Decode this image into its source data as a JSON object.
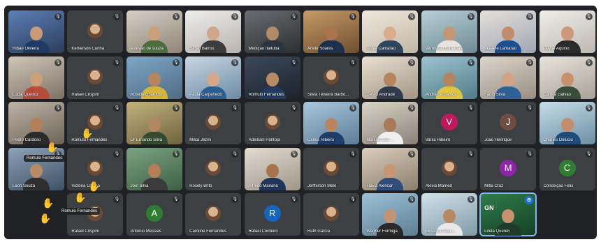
{
  "colors": {
    "stage_background": "#202124",
    "tile_background": "#3c4043",
    "pin_accent": "#1a73e8"
  },
  "participants": [
    {
      "name": "Ribão Oliveira",
      "kind": "video",
      "c1": "#5b7fb6",
      "c2": "#2d3d5a",
      "skin": "#c99a76",
      "shirt": "#1f3a63"
    },
    {
      "name": "Kemerson Cunha",
      "kind": "photo",
      "mic_muted": true
    },
    {
      "name": "estevão de souza",
      "kind": "video",
      "c1": "#d6cfc4",
      "c2": "#8f8578",
      "skin": "#c9a07a",
      "shirt": "#4d6d3f"
    },
    {
      "name": "Sarah Barros",
      "kind": "video",
      "c1": "#eeeeee",
      "c2": "#b9b3ad",
      "skin": "#d2a689",
      "shirt": "#3c3c3c"
    },
    {
      "name": "Medição Itaituba",
      "kind": "video",
      "c1": "#6a6d71",
      "c2": "#2c2e31",
      "skin": "#b48a68",
      "shirt": "#2b3540"
    },
    {
      "name": "Arlete Soares",
      "kind": "video",
      "c1": "#c79a68",
      "c2": "#6e4e30",
      "skin": "#a9744f",
      "shirt": "#1e2f4d"
    },
    {
      "name": "Sonia Camarão",
      "kind": "video",
      "c1": "#efe8dc",
      "c2": "#c2b7a6",
      "skin": "#d9ad8b",
      "shirt": "#2d4660"
    },
    {
      "name": "Verônica Guimarães",
      "kind": "video",
      "c1": "#b7d0d7",
      "c2": "#6f8a93",
      "skin": "#c79773",
      "shirt": "#e8e3dd"
    },
    {
      "name": "Mikaele Lamarão",
      "kind": "video",
      "c1": "#e5e0d9",
      "c2": "#9fa6b4",
      "skin": "#c18c67",
      "shirt": "#1d4f8f"
    },
    {
      "name": "Dayse Aquino",
      "kind": "video",
      "c1": "#f0eeea",
      "c2": "#bdb7b0",
      "skin": "#cc9a78",
      "shirt": "#2b2b2b"
    },
    {
      "name": "Luiza Queiroz",
      "kind": "video",
      "c1": "#cfc6ba",
      "c2": "#7d7266",
      "skin": "#c9a07a",
      "shirt": "#b84a3a"
    },
    {
      "name": "Rafael Crispim",
      "kind": "photo",
      "mic_muted": true
    },
    {
      "name": "Rosicleto Santos",
      "kind": "video",
      "c1": "#7fa7c9",
      "c2": "#4e6b84",
      "skin": "#b8845f",
      "shirt": "#d4b43a"
    },
    {
      "name": "Paula Carpenedo",
      "kind": "video",
      "c1": "#c8d7e3",
      "c2": "#6d8aa5",
      "skin": "#d5a88a",
      "shirt": "#2e5d8f"
    },
    {
      "name": "Romulo Fernandes",
      "kind": "video",
      "c1": "#3c4a5c",
      "c2": "#1b222b",
      "skin": "#b98a66",
      "shirt": "#223a5e"
    },
    {
      "name": "Silvia Teixeira Barbo...",
      "kind": "photo",
      "mic_muted": true
    },
    {
      "name": "Delvid Andrade",
      "kind": "video",
      "c1": "#e8e0d3",
      "c2": "#a39584",
      "skin": "#b78460",
      "shirt": "#2f3a4d"
    },
    {
      "name": "André de Santos",
      "kind": "video",
      "c1": "#9fc3d1",
      "c2": "#4f7c88",
      "skin": "#b5835e",
      "shirt": "#e0c540"
    },
    {
      "name": "Fábio Silva",
      "kind": "video",
      "c1": "#ddd6cc",
      "c2": "#988d80",
      "skin": "#d1a286",
      "shirt": "#2f5f94"
    },
    {
      "name": "Camila Galvão",
      "kind": "video",
      "c1": "#e8e3dc",
      "c2": "#a9a199",
      "skin": "#c7936f",
      "shirt": "#3a4d3a"
    },
    {
      "name": "Pedro Cardoso",
      "kind": "video",
      "c1": "#bdb3a6",
      "c2": "#6d6459",
      "skin": "#b3805b",
      "shirt": "#2b2b2b"
    },
    {
      "name": "Romulo Fernandes",
      "kind": "photo",
      "mic_muted": true
    },
    {
      "name": "Dr Ernando Silva",
      "kind": "video",
      "c1": "#c2b27c",
      "c2": "#6e6340",
      "skin": "#b48763",
      "shirt": "#344b2f"
    },
    {
      "name": "Milca Jezini",
      "kind": "photo",
      "mic_muted": true
    },
    {
      "name": "Adeilson Pantoja",
      "kind": "photo",
      "mic_muted": true
    },
    {
      "name": "Carlos Ribeiro",
      "kind": "video",
      "c1": "#a9c7de",
      "c2": "#5c7d97",
      "skin": "#b9865f",
      "shirt": "#1f3d6a"
    },
    {
      "name": "Manutenção ...",
      "kind": "video",
      "c1": "#d9d3c8",
      "c2": "#8b8276",
      "skin": "#a97a57",
      "shirt": "#f0f0f0"
    },
    {
      "name": "Vania Ribeiro",
      "kind": "letter",
      "letter": "V",
      "color": "#c2185b"
    },
    {
      "name": "João Henrique",
      "kind": "letter",
      "letter": "J",
      "color": "#6d4c41"
    },
    {
      "name": "Charles Delúcio",
      "kind": "video",
      "c1": "#c7dde8",
      "c2": "#6b8fa3",
      "skin": "#c38e6a",
      "shirt": "#1f4b7a"
    },
    {
      "name": "Leon Souza",
      "kind": "video",
      "c1": "#8da3b8",
      "c2": "#3f5064",
      "skin": "#b98a66",
      "shirt": "#2f2f2f"
    },
    {
      "name": "Victória Coelho",
      "kind": "photo",
      "mic_muted": true
    },
    {
      "name": "Joel Silva",
      "kind": "video",
      "c1": "#7ba383",
      "c2": "#3e5f44",
      "skin": "#b37e58",
      "shirt": "#3b3b3b"
    },
    {
      "name": "Rosely Brito",
      "kind": "photo",
      "mic_muted": true
    },
    {
      "name": "Alfredo Mariano",
      "kind": "video",
      "c1": "#e2dbd0",
      "c2": "#a0968a",
      "skin": "#a8744e",
      "shirt": "#1e3659"
    },
    {
      "name": "Jerfferson Melo",
      "kind": "photo",
      "mic_muted": true
    },
    {
      "name": "Flávia Alencar",
      "kind": "video",
      "c1": "#d9cdbd",
      "c2": "#8c7e6c",
      "skin": "#c89673",
      "shirt": "#2f4d7a"
    },
    {
      "name": "Alexia Mamed",
      "kind": "photo",
      "mic_muted": true
    },
    {
      "name": "Mitla Cruz",
      "kind": "letter",
      "letter": "M",
      "color": "#8e24aa"
    },
    {
      "name": "Conceição Félix",
      "kind": "letter",
      "letter": "C",
      "color": "#2e7d32"
    },
    {
      "name": "Romulo Fernandes",
      "kind": "empty"
    },
    {
      "name": "Rafael Crispim",
      "kind": "photo",
      "mic_muted": true
    },
    {
      "name": "Antonio Messias",
      "kind": "letter",
      "letter": "A",
      "color": "#2e7d32"
    },
    {
      "name": "Caroline Fernandes",
      "kind": "photo",
      "mic_muted": true
    },
    {
      "name": "Rafael Cordeiro",
      "kind": "letter",
      "letter": "R",
      "color": "#1565c0"
    },
    {
      "name": "Ruth Garcia",
      "kind": "photo",
      "mic_muted": true
    },
    {
      "name": "Wagner Formiga",
      "kind": "video",
      "c1": "#9cc1d8",
      "c2": "#5d7f92",
      "skin": "#c39473",
      "shirt": "#2a2a2a"
    },
    {
      "name": "Eligelson Andr...",
      "kind": "video",
      "c1": "#d1e2ea",
      "c2": "#7f9aa6",
      "skin": "#ba8763",
      "shirt": "#e8e8e8"
    },
    {
      "name": "Linda Queren",
      "kind": "video",
      "c1": "#2f7d4a",
      "c2": "#163f25",
      "skin": "#c7936f",
      "shirt": "#203b2a",
      "active": true
    }
  ],
  "overlays": {
    "hand_label_1": "Romulo Fernandes",
    "hand_label_2": "Romulo Fernandes",
    "tile_logo": "GN"
  }
}
